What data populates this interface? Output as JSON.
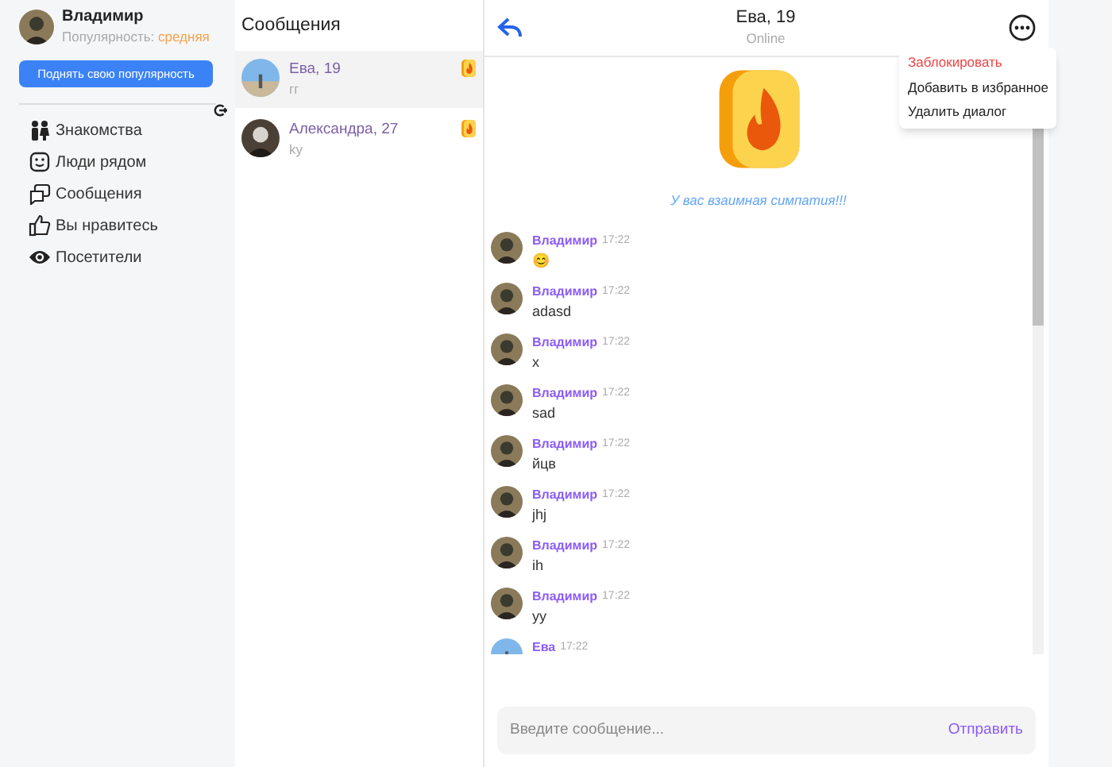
{
  "profile": {
    "name": "Владимир",
    "popularity_label": "Популярность:",
    "popularity_value": "средняя",
    "boost_button": "Поднять свою популярность"
  },
  "nav": [
    {
      "kind": "people",
      "label": "Знакомства"
    },
    {
      "kind": "smile",
      "label": "Люди рядом"
    },
    {
      "kind": "chat",
      "label": "Сообщения"
    },
    {
      "kind": "like",
      "label": "Вы нравитесь"
    },
    {
      "kind": "eye",
      "label": "Посетители"
    }
  ],
  "conversations": {
    "title": "Сообщения",
    "items": [
      {
        "name": "Ева, 19",
        "preview": "гг",
        "selected": true
      },
      {
        "name": "Александра, 27",
        "preview": "ky",
        "selected": false
      }
    ]
  },
  "chat": {
    "title": "Ева, 19",
    "status": "Online",
    "match_text": "У вас взаимная симпатия!!!",
    "menu": [
      {
        "label": "Заблокировать",
        "kind": "danger"
      },
      {
        "label": "Добавить в избранное",
        "kind": "normal"
      },
      {
        "label": "Удалить диалог",
        "kind": "normal"
      }
    ],
    "messages": [
      {
        "author": "Владимир",
        "time": "17:22",
        "text": "😊"
      },
      {
        "author": "Владимир",
        "time": "17:22",
        "text": "adasd"
      },
      {
        "author": "Владимир",
        "time": "17:22",
        "text": "x"
      },
      {
        "author": "Владимир",
        "time": "17:22",
        "text": "sad"
      },
      {
        "author": "Владимир",
        "time": "17:22",
        "text": "йцв"
      },
      {
        "author": "Владимир",
        "time": "17:22",
        "text": "jhj"
      },
      {
        "author": "Владимир",
        "time": "17:22",
        "text": "ih"
      },
      {
        "author": "Владимир",
        "time": "17:22",
        "text": "yy"
      },
      {
        "author": "Ева",
        "time": "17:22"
      }
    ],
    "input": {
      "placeholder": "Введите сообщение..."
    },
    "send_button": "Отправить"
  }
}
